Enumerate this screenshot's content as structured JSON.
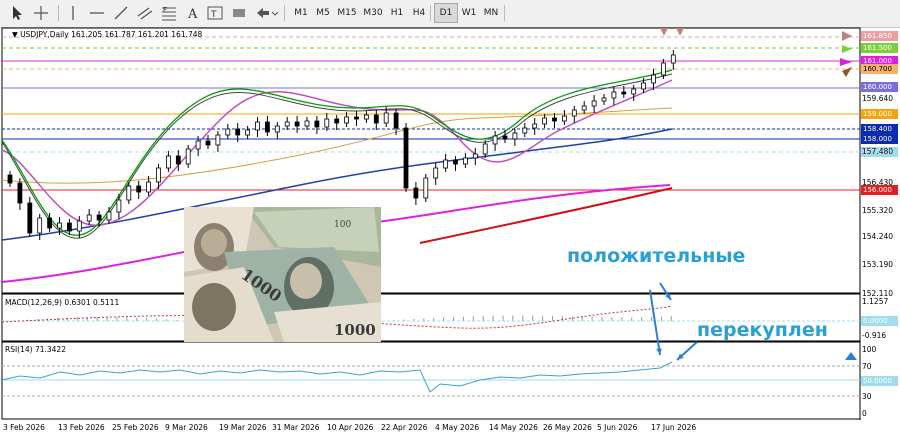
{
  "toolbar": {
    "timeframes": [
      "M1",
      "M5",
      "M15",
      "M30",
      "H1",
      "H4",
      "D1",
      "W1",
      "MN"
    ],
    "active_timeframe": "D1",
    "tools": [
      "cursor-icon",
      "crosshair-icon",
      "vertical-line-icon",
      "horizontal-line-icon",
      "trendline-icon",
      "equidistant-channel-icon",
      "fibonacci-icon",
      "text-icon",
      "text-label-icon",
      "shapes-icon",
      "arrows-icon"
    ]
  },
  "chart": {
    "header": "USDJPY,Daily  161.205 161.787 161.201 161.748",
    "symbol": "USDJPY",
    "ohlc_close": "161.748"
  },
  "price_labels": [
    {
      "text": "161.850",
      "color": "#e9a0a4",
      "text_color": "#ffffff"
    },
    {
      "text": "161.500",
      "color": "#7ccf3a",
      "text_color": "#ffffff"
    },
    {
      "text": "161.000",
      "color": "#e020e0",
      "text_color": "#ffffff"
    },
    {
      "text": "160.700",
      "color": "#f7b26a",
      "text_color": "#000000"
    },
    {
      "text": "160.000",
      "color": "#7a6fd8",
      "text_color": "#ffffff"
    },
    {
      "text": "159.000",
      "color": "#f3a40e",
      "text_color": "#ffffff"
    },
    {
      "text": "158.400",
      "color": "#0a2bb0",
      "text_color": "#ffffff"
    },
    {
      "text": "158.000",
      "color": "#0a2bb0",
      "text_color": "#ffffff"
    },
    {
      "text": "157.500",
      "color": "#9fdcf0",
      "text_color": "#ffffff"
    },
    {
      "text": "156.000",
      "color": "#e02020",
      "text_color": "#ffffff"
    }
  ],
  "price_axis": [
    "161.850",
    "159.640",
    "157.480",
    "156.430",
    "155.320",
    "154.240",
    "153.190",
    "152.110"
  ],
  "macd": {
    "label": "MACD(12,26,9) 0.6301 0.5111",
    "axis_top": "1.1257",
    "zero_label": "0.0000",
    "axis_bottom": "-0.916"
  },
  "rsi": {
    "label": "RSI(14) 71.3422",
    "axis": [
      "100",
      "70",
      "50.0000",
      "30",
      "0"
    ]
  },
  "dates": [
    "3 Feb 2026",
    "13 Feb 2026",
    "25 Feb 2026",
    "9 Mar 2026",
    "19 Mar 2026",
    "31 Mar 2026",
    "10 Apr 2026",
    "22 Apr 2026",
    "4 May 2026",
    "14 May 2026",
    "26 May 2026",
    "5 Jun 2026",
    "17 Jun 2026"
  ],
  "annotations": {
    "positive": "положительные",
    "overbought": "перекуплен"
  },
  "colors": {
    "candle": "#000000",
    "ma_fast": "#00a000",
    "ma_mid": "#c050c0",
    "ma_slow": "#1f3fb0",
    "ma_200": "#d21010",
    "ma_long": "#e020e0",
    "ma_tan": "#d9a03a",
    "annotation": "#2a9fd6"
  }
}
